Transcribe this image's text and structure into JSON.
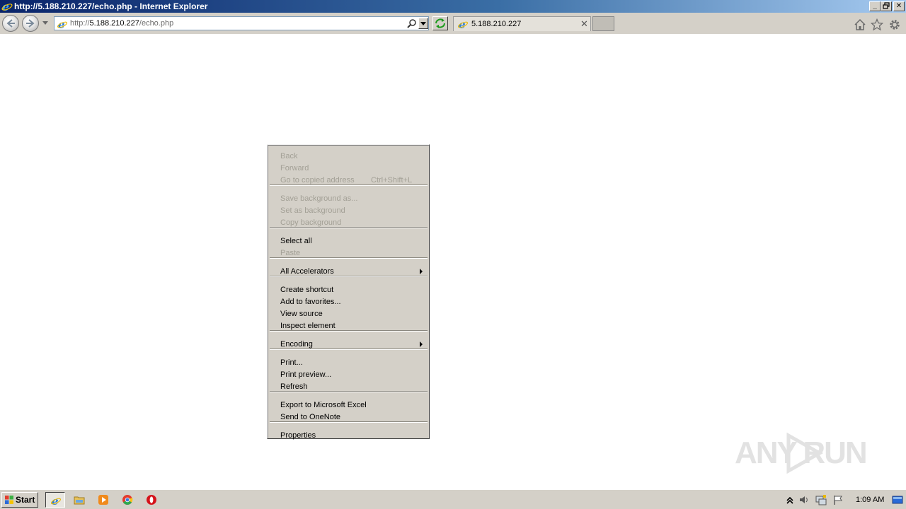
{
  "window": {
    "title": "http://5.188.210.227/echo.php - Internet Explorer",
    "controls": [
      "minimize",
      "restore",
      "close"
    ]
  },
  "navbar": {
    "back_icon": "back-arrow-icon",
    "forward_icon": "forward-arrow-icon",
    "address": {
      "scheme": "http://",
      "host": "5.188.210.227",
      "path": "/echo.php"
    },
    "tab": {
      "label": "5.188.210.227",
      "close_glyph": "✕"
    },
    "tools": [
      "home-icon",
      "favorites-star-icon",
      "gear-icon"
    ]
  },
  "context_menu": {
    "groups": [
      [
        {
          "label": "Back",
          "enabled": false
        },
        {
          "label": "Forward",
          "enabled": false
        },
        {
          "label": "Go to copied address",
          "shortcut": "Ctrl+Shift+L",
          "enabled": false
        }
      ],
      [
        {
          "label": "Save background as...",
          "enabled": false
        },
        {
          "label": "Set as background",
          "enabled": false
        },
        {
          "label": "Copy background",
          "enabled": false
        }
      ],
      [
        {
          "label": "Select all",
          "enabled": true
        },
        {
          "label": "Paste",
          "enabled": false
        }
      ],
      [
        {
          "label": "All Accelerators",
          "enabled": true,
          "submenu": true
        }
      ],
      [
        {
          "label": "Create shortcut",
          "enabled": true
        },
        {
          "label": "Add to favorites...",
          "enabled": true
        },
        {
          "label": "View source",
          "enabled": true
        },
        {
          "label": "Inspect element",
          "enabled": true
        }
      ],
      [
        {
          "label": "Encoding",
          "enabled": true,
          "submenu": true
        }
      ],
      [
        {
          "label": "Print...",
          "enabled": true
        },
        {
          "label": "Print preview...",
          "enabled": true
        },
        {
          "label": "Refresh",
          "enabled": true
        }
      ],
      [
        {
          "label": "Export to Microsoft Excel",
          "enabled": true
        },
        {
          "label": "Send to OneNote",
          "enabled": true
        }
      ],
      [
        {
          "label": "Properties",
          "enabled": true
        }
      ]
    ]
  },
  "watermark": {
    "text": "ANY RUN"
  },
  "taskbar": {
    "start_label": "Start",
    "apps": [
      "internet-explorer-icon",
      "file-explorer-icon",
      "media-player-icon",
      "chrome-icon",
      "opera-icon"
    ],
    "tray_icons": [
      "show-hidden-icons-icon",
      "volume-icon",
      "network-icon",
      "action-center-flag-icon"
    ],
    "clock": "1:09 AM"
  }
}
